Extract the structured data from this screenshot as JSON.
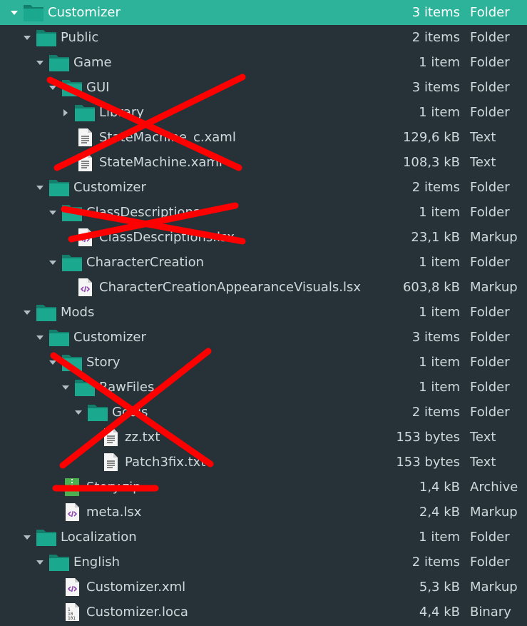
{
  "colors": {
    "background": "#263238",
    "selection": "#2db39a",
    "folder": "#1aa88f",
    "folder_dark": "#127f6c",
    "text": "#cfd8dc",
    "annotation": "#ff0000"
  },
  "rows": [
    {
      "name": "Customizer",
      "size": "3 items",
      "kind": "Folder",
      "icon": "folder-icon",
      "depth": 0,
      "expander": "down",
      "selected": true
    },
    {
      "name": "Public",
      "size": "2 items",
      "kind": "Folder",
      "icon": "folder-icon",
      "depth": 1,
      "expander": "down"
    },
    {
      "name": "Game",
      "size": "1 item",
      "kind": "Folder",
      "icon": "folder-icon",
      "depth": 2,
      "expander": "down"
    },
    {
      "name": "GUI",
      "size": "3 items",
      "kind": "Folder",
      "icon": "folder-icon",
      "depth": 3,
      "expander": "down"
    },
    {
      "name": "Library",
      "size": "1 item",
      "kind": "Folder",
      "icon": "folder-icon",
      "depth": 4,
      "expander": "right"
    },
    {
      "name": "StateMachine_c.xaml",
      "size": "129,6 kB",
      "kind": "Text",
      "icon": "text-file-icon",
      "depth": 4,
      "expander": "none"
    },
    {
      "name": "StateMachine.xaml",
      "size": "108,3 kB",
      "kind": "Text",
      "icon": "text-file-icon",
      "depth": 4,
      "expander": "none"
    },
    {
      "name": "Customizer",
      "size": "2 items",
      "kind": "Folder",
      "icon": "folder-icon",
      "depth": 2,
      "expander": "down"
    },
    {
      "name": "ClassDescriptions",
      "size": "1 item",
      "kind": "Folder",
      "icon": "folder-icon",
      "depth": 3,
      "expander": "down"
    },
    {
      "name": "ClassDescriptions.lsx",
      "size": "23,1 kB",
      "kind": "Markup",
      "icon": "markup-file-icon",
      "depth": 4,
      "expander": "none"
    },
    {
      "name": "CharacterCreation",
      "size": "1 item",
      "kind": "Folder",
      "icon": "folder-icon",
      "depth": 3,
      "expander": "down"
    },
    {
      "name": "CharacterCreationAppearanceVisuals.lsx",
      "size": "603,8 kB",
      "kind": "Markup",
      "icon": "markup-file-icon",
      "depth": 4,
      "expander": "none"
    },
    {
      "name": "Mods",
      "size": "1 item",
      "kind": "Folder",
      "icon": "folder-icon",
      "depth": 1,
      "expander": "down"
    },
    {
      "name": "Customizer",
      "size": "3 items",
      "kind": "Folder",
      "icon": "folder-icon",
      "depth": 2,
      "expander": "down"
    },
    {
      "name": "Story",
      "size": "1 item",
      "kind": "Folder",
      "icon": "folder-icon",
      "depth": 3,
      "expander": "down"
    },
    {
      "name": "RawFiles",
      "size": "1 item",
      "kind": "Folder",
      "icon": "folder-icon",
      "depth": 4,
      "expander": "down"
    },
    {
      "name": "Goals",
      "size": "2 items",
      "kind": "Folder",
      "icon": "folder-icon",
      "depth": 5,
      "expander": "down"
    },
    {
      "name": "zz.txt",
      "size": "153 bytes",
      "kind": "Text",
      "icon": "text-file-icon",
      "depth": 6,
      "expander": "none"
    },
    {
      "name": "Patch3fix.txt",
      "size": "153 bytes",
      "kind": "Text",
      "icon": "text-file-icon",
      "depth": 6,
      "expander": "none"
    },
    {
      "name": "Story.zip",
      "size": "1,4 kB",
      "kind": "Archive",
      "icon": "archive-file-icon",
      "depth": 3,
      "expander": "none"
    },
    {
      "name": "meta.lsx",
      "size": "2,4 kB",
      "kind": "Markup",
      "icon": "markup-file-icon",
      "depth": 3,
      "expander": "none"
    },
    {
      "name": "Localization",
      "size": "1 item",
      "kind": "Folder",
      "icon": "folder-icon",
      "depth": 1,
      "expander": "down"
    },
    {
      "name": "English",
      "size": "2 items",
      "kind": "Folder",
      "icon": "folder-icon",
      "depth": 2,
      "expander": "down"
    },
    {
      "name": "Customizer.xml",
      "size": "5,3 kB",
      "kind": "Markup",
      "icon": "markup-file-icon",
      "depth": 3,
      "expander": "none"
    },
    {
      "name": "Customizer.loca",
      "size": "4,4 kB",
      "kind": "Binary",
      "icon": "binary-file-icon",
      "depth": 3,
      "expander": "none"
    }
  ]
}
